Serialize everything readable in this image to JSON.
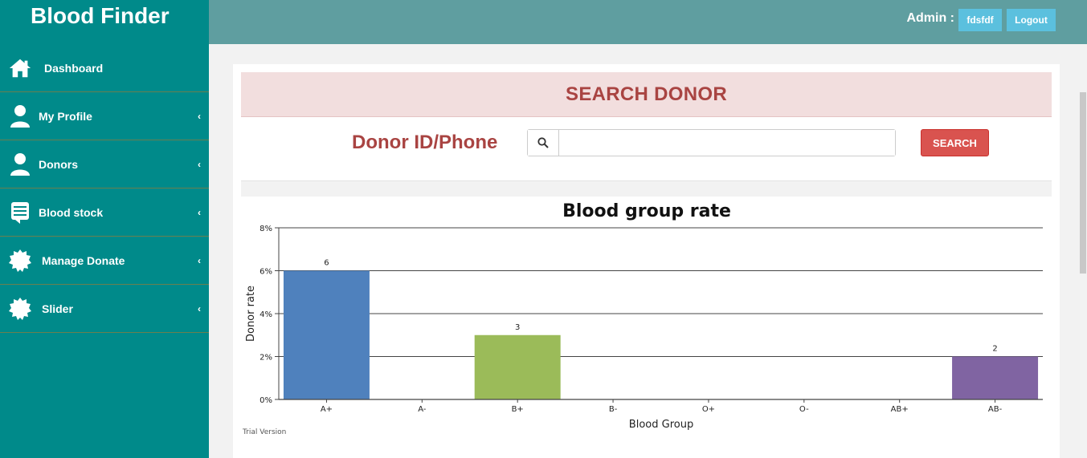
{
  "brand": "Blood Finder",
  "sidebar": {
    "items": [
      {
        "label": "Dashboard",
        "icon": "home-icon",
        "has_chevron": false
      },
      {
        "label": "My Profile",
        "icon": "user-icon",
        "has_chevron": true
      },
      {
        "label": "Donors",
        "icon": "user-icon",
        "has_chevron": true
      },
      {
        "label": "Blood stock",
        "icon": "list-icon",
        "has_chevron": true
      },
      {
        "label": "Manage Donate",
        "icon": "badge-icon",
        "has_chevron": true
      },
      {
        "label": "Slider",
        "icon": "badge-icon",
        "has_chevron": true
      }
    ],
    "chevron": "‹"
  },
  "topbar": {
    "admin_label": "Admin :",
    "user_button": "fdsfdf",
    "logout_button": "Logout"
  },
  "search": {
    "header": "SEARCH DONOR",
    "field_label": "Donor ID/Phone",
    "input_value": "",
    "button_label": "SEARCH"
  },
  "colors": {
    "sidebar": "#008a8a",
    "topbar": "#5f9ea0",
    "accent_red": "#a94442",
    "button_info": "#5bc0de",
    "button_danger": "#d9534f"
  },
  "chart_data": {
    "type": "bar",
    "title": "Blood group rate",
    "xlabel": "Blood Group",
    "ylabel": "Donor rate",
    "categories": [
      "A+",
      "A-",
      "B+",
      "B-",
      "O+",
      "O-",
      "AB+",
      "AB-"
    ],
    "values": [
      6,
      0,
      3,
      0,
      0,
      0,
      0,
      2
    ],
    "bar_colors": [
      "#4f81bd",
      "#4f81bd",
      "#9bbb59",
      "#9bbb59",
      "#9bbb59",
      "#9bbb59",
      "#9bbb59",
      "#8064a2"
    ],
    "yticks": [
      "0%",
      "2%",
      "4%",
      "6%",
      "8%"
    ],
    "ylim": [
      0,
      8
    ],
    "grid": true,
    "watermark": "Trial Version"
  }
}
